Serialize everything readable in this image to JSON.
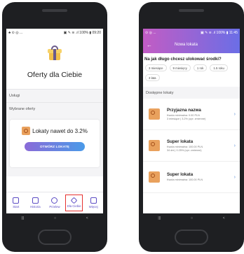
{
  "left_phone": {
    "status_bar": {
      "left": "♣ ⊙ ◎ ...",
      "right": "▣ ✎ ≋ .ıl 100% ▮ 09:20"
    },
    "gift_icon": "gift-icon",
    "title": "Oferty dla Ciebie",
    "sections": [
      "Usługi",
      "Wybrane oferty"
    ],
    "card": {
      "headline": "Lokaty nawet do 3.2%",
      "button": "OTWÓRZ LOKATĘ"
    },
    "tabs": [
      {
        "label": "Start",
        "icon": "home-icon"
      },
      {
        "label": "Historia",
        "icon": "history-icon"
      },
      {
        "label": "Przelew",
        "icon": "transfer-icon"
      },
      {
        "label": "Dla Ciebie",
        "icon": "tag-icon",
        "active": true
      },
      {
        "label": "Więcej",
        "icon": "grid-icon"
      }
    ],
    "system_nav": [
      "|||",
      "○",
      "<"
    ]
  },
  "right_phone": {
    "status_bar": {
      "left": "⊙ ◎ ...",
      "right": "▣ ✎ ≋ .ıl 100% ▮ 11:45"
    },
    "header": {
      "back": "←",
      "title": "Nowa lokata"
    },
    "question": "Na jak długo chcesz ulokować środki?",
    "chips": [
      "3 miesiące",
      "9 miesięcy",
      "1 rok",
      "1.5 roku",
      "3 lata"
    ],
    "section": "Dostępne lokaty",
    "items": [
      {
        "name": "Przyjazna nazwa",
        "line1": "Kwota minimalna: 0.00 PLN",
        "line2": "3 miesiące  |  3.2% (opr. zmienne)"
      },
      {
        "name": "Super lokata",
        "line1": "Kwota minimalna: 100.00 PLN",
        "line2": "34 dni  |  0.25% (opr. zmienne)"
      },
      {
        "name": "Super lokata",
        "line1": "Kwota minimalna: 100.00 PLN",
        "line2": ""
      }
    ],
    "system_nav": [
      "|||",
      "○",
      "<"
    ]
  },
  "colors": {
    "accent": "#5b4bc4",
    "gradient_start": "#c25cc4",
    "gradient_end": "#6b6ee6",
    "highlight": "#e5312f"
  }
}
